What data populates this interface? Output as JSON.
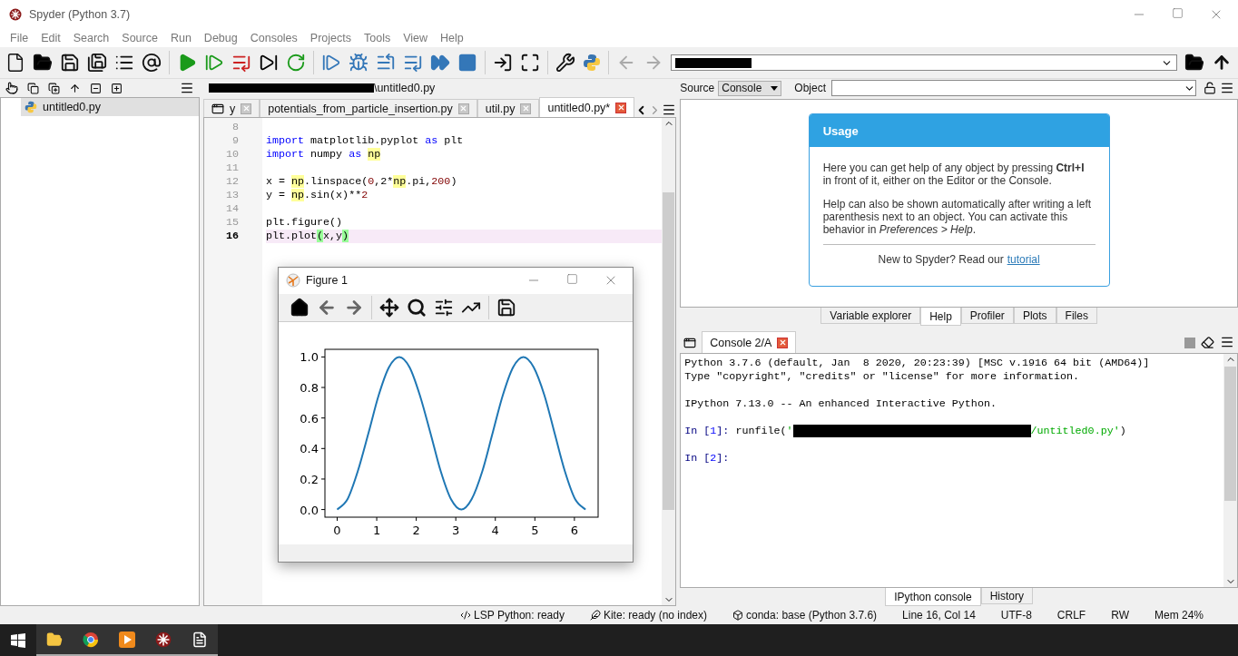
{
  "window": {
    "title": "Spyder (Python 3.7)"
  },
  "menu": [
    "File",
    "Edit",
    "Search",
    "Source",
    "Run",
    "Debug",
    "Consoles",
    "Projects",
    "Tools",
    "View",
    "Help"
  ],
  "file_explorer": {
    "items": [
      {
        "label": "untitled0.py",
        "selected": true
      }
    ]
  },
  "editor": {
    "path": "\\untitled0.py",
    "tabs": [
      {
        "label": "y",
        "selected": false
      },
      {
        "label": "potentials_from_particle_insertion.py",
        "selected": false
      },
      {
        "label": "util.py",
        "selected": false
      },
      {
        "label": "untitled0.py*",
        "selected": true
      }
    ],
    "lines": [
      {
        "number": "8",
        "current": false
      },
      {
        "number": "9",
        "current": false,
        "tokens": [
          {
            "text": "import",
            "kind": "keyword"
          },
          {
            "text": " matplotlib.pyplot ",
            "kind": "plain"
          },
          {
            "text": "as",
            "kind": "keyword"
          },
          {
            "text": " plt",
            "kind": "plain"
          }
        ]
      },
      {
        "number": "10",
        "current": false,
        "tokens": [
          {
            "text": "import",
            "kind": "keyword"
          },
          {
            "text": " numpy ",
            "kind": "plain"
          },
          {
            "text": "as ",
            "kind": "keyword"
          },
          {
            "text": "np",
            "kind": "occurrence"
          }
        ]
      },
      {
        "number": "11",
        "current": false
      },
      {
        "number": "12",
        "current": false,
        "tokens": [
          {
            "text": "x = ",
            "kind": "plain"
          },
          {
            "text": "np",
            "kind": "occurrence"
          },
          {
            "text": ".linspace(",
            "kind": "plain"
          },
          {
            "text": "0",
            "kind": "number"
          },
          {
            "text": ",2*",
            "kind": "plain"
          },
          {
            "text": "np",
            "kind": "occurrence"
          },
          {
            "text": ".pi,",
            "kind": "plain"
          },
          {
            "text": "200",
            "kind": "number"
          },
          {
            "text": ")",
            "kind": "plain"
          }
        ]
      },
      {
        "number": "13",
        "current": false,
        "tokens": [
          {
            "text": "y = ",
            "kind": "plain"
          },
          {
            "text": "np",
            "kind": "occurrence"
          },
          {
            "text": ".sin(x)**",
            "kind": "plain"
          },
          {
            "text": "2",
            "kind": "number"
          }
        ]
      },
      {
        "number": "14",
        "current": false
      },
      {
        "number": "15",
        "current": false,
        "tokens": [
          {
            "text": "plt.figure()",
            "kind": "plain"
          }
        ]
      },
      {
        "number": "16",
        "current": true,
        "tokens": [
          {
            "text": "plt.plot",
            "kind": "plain"
          },
          {
            "text": "(",
            "kind": "match"
          },
          {
            "text": "x,y",
            "kind": "plain"
          },
          {
            "text": ")",
            "kind": "match"
          }
        ]
      }
    ]
  },
  "help": {
    "source_label": "Source",
    "source_value": "Console",
    "object_label": "Object",
    "card": {
      "title": "Usage",
      "paragraphs": [
        "Here you can get help of any object by pressing **Ctrl+I** in front of it, either on the Editor or the Console.",
        "Help can also be shown automatically after writing a left parenthesis next to an object. You can activate this behavior in *Preferences > Help*."
      ],
      "footer": {
        "text": "New to Spyder? Read our",
        "link": "tutorial"
      }
    },
    "tabs": [
      {
        "label": "Variable explorer",
        "selected": false
      },
      {
        "label": "Help",
        "selected": true
      },
      {
        "label": "Profiler",
        "selected": false
      },
      {
        "label": "Plots",
        "selected": false
      },
      {
        "label": "Files",
        "selected": false
      }
    ]
  },
  "console": {
    "tab": "Console 2/A",
    "blocks": [
      {
        "lines": [
          [
            {
              "text": "Python 3.7.6 (default, Jan  8 2020, 20:23:39) [MSC v.1916 64 bit (AMD64)]",
              "kind": "plain"
            }
          ],
          [
            {
              "text": "Type \"copyright\", \"credits\" or \"license\" for more information.",
              "kind": "plain"
            }
          ]
        ]
      },
      {
        "lines": [
          [
            {
              "text": "IPython 7.13.0 -- An enhanced Interactive Python.",
              "kind": "plain"
            }
          ]
        ]
      },
      {
        "lines": [
          [
            {
              "text": "In [",
              "kind": "prompt"
            },
            {
              "text": "1",
              "kind": "prompt_number"
            },
            {
              "text": "]: ",
              "kind": "prompt"
            },
            {
              "text": "runfile(",
              "kind": "plain"
            },
            {
              "text": "'",
              "kind": "string"
            },
            {
              "kind": "redacted"
            },
            {
              "text": "/untitled0.py'",
              "kind": "string"
            },
            {
              "text": ")",
              "kind": "plain"
            }
          ]
        ]
      },
      {
        "lines": [
          [
            {
              "text": "In [",
              "kind": "prompt"
            },
            {
              "text": "2",
              "kind": "prompt_number"
            },
            {
              "text": "]:",
              "kind": "prompt"
            }
          ]
        ]
      }
    ],
    "tabs": [
      {
        "label": "IPython console",
        "selected": true
      },
      {
        "label": "History",
        "selected": false
      }
    ]
  },
  "status": [
    {
      "kind": "lsp",
      "text": "LSP Python: ready"
    },
    {
      "kind": "kite",
      "text": "Kite: ready (no index)"
    },
    {
      "kind": "conda",
      "text": "conda: base (Python 3.7.6)"
    },
    {
      "kind": "plain",
      "text": "Line 16, Col 14"
    },
    {
      "kind": "plain",
      "text": "UTF-8"
    },
    {
      "kind": "plain",
      "text": "CRLF"
    },
    {
      "kind": "plain",
      "text": "RW"
    },
    {
      "kind": "plain",
      "text": "Mem 24%"
    }
  ],
  "figure": {
    "title": "Figure 1",
    "chart_data": {
      "type": "line",
      "x": [
        0,
        0.26,
        0.52,
        0.79,
        1.05,
        1.31,
        1.57,
        1.83,
        2.09,
        2.36,
        2.62,
        2.88,
        3.14,
        3.4,
        3.67,
        3.93,
        4.19,
        4.45,
        4.71,
        4.97,
        5.24,
        5.5,
        5.76,
        6.02,
        6.28
      ],
      "series": [
        {
          "color": "#1f77b4",
          "values": [
            0,
            0.067,
            0.25,
            0.5,
            0.75,
            0.933,
            1,
            0.933,
            0.75,
            0.5,
            0.25,
            0.067,
            0,
            0.067,
            0.25,
            0.5,
            0.75,
            0.933,
            1,
            0.933,
            0.75,
            0.5,
            0.25,
            0.067,
            0
          ]
        }
      ],
      "xlim": [
        -0.31,
        6.6
      ],
      "ylim": [
        -0.05,
        1.05
      ],
      "xticks": [
        0,
        1,
        2,
        3,
        4,
        5,
        6
      ],
      "yticks": [
        {
          "value": 0,
          "label": "0.0"
        },
        {
          "value": 0.2,
          "label": "0.2"
        },
        {
          "value": 0.4,
          "label": "0.4"
        },
        {
          "value": 0.6,
          "label": "0.6"
        },
        {
          "value": 0.8,
          "label": "0.8"
        },
        {
          "value": 1,
          "label": "1.0"
        }
      ]
    }
  }
}
